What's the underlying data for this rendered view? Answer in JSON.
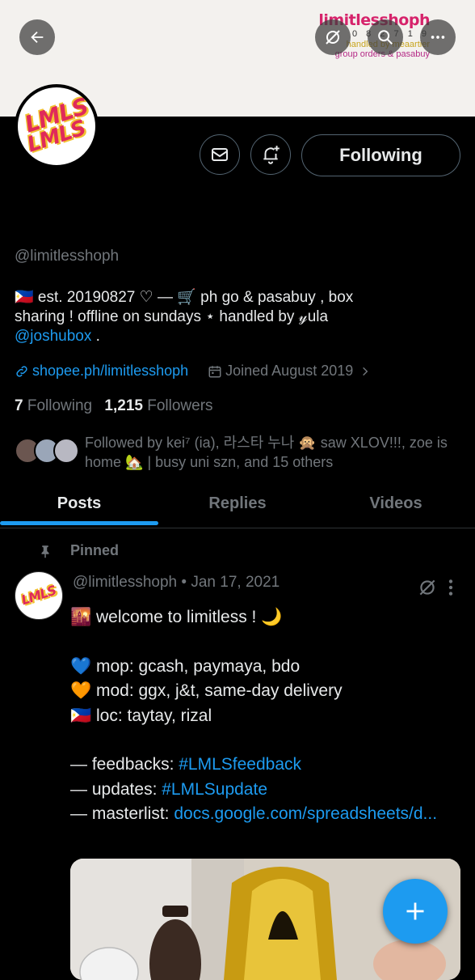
{
  "banner": {
    "brand_title": "limitlesshoph",
    "brand_line1": "0 8 2 7 1 9",
    "brand_line2": "handled by meaartier",
    "brand_line3": "group orders & pasabuy"
  },
  "header_icons": [
    "back-arrow-icon",
    "grok-icon",
    "search-icon",
    "more-icon"
  ],
  "profile": {
    "logo_text_1": "LMLS",
    "logo_text_2": "LMLS",
    "handle": "@limitlesshoph",
    "bio_line1": "🇵🇭 est. 20190827 ♡ — 🛒 ph go & pasabuy , box",
    "bio_line2": "sharing ! offline on sundays ⋆ handled by 𝓎ula",
    "bio_mention": "@joshubox",
    "bio_end": " .",
    "website": "shopee.ph/limitlesshoph",
    "joined": "Joined August 2019",
    "following_count": "7",
    "following_label": "Following",
    "followers_count": "1,215",
    "followers_label": "Followers",
    "followed_by": "Followed by kei⁷ (ia), 라스타 누나 🙊 saw XLOV!!!, zoe is home 🏡 | busy uni szn, and 15 others"
  },
  "actions": {
    "following_button": "Following"
  },
  "tabs": [
    {
      "label": "Posts",
      "active": true
    },
    {
      "label": "Replies",
      "active": false
    },
    {
      "label": "Videos",
      "active": false
    }
  ],
  "post": {
    "pinned_label": "Pinned",
    "author": "@limitlesshoph",
    "date": "• Jan 17, 2021",
    "line1": "🌇 welcome to limitless ! 🌙",
    "line2": "💙 mop: gcash, paymaya, bdo",
    "line3": "🧡 mod: ggx, j&t, same-day delivery",
    "line4": "🇵🇭 loc: taytay, rizal",
    "fb_prefix": "— feedbacks: ",
    "fb_tag": "#LMLSfeedback",
    "up_prefix": "— updates: ",
    "up_tag": "#LMLSupdate",
    "ml_prefix": "— masterlist: ",
    "ml_link": "docs.google.com/spreadsheets/d..."
  },
  "colors": {
    "accent": "#1d9bf0",
    "background": "#000000",
    "muted": "#71767b",
    "text": "#e7e9ea"
  }
}
